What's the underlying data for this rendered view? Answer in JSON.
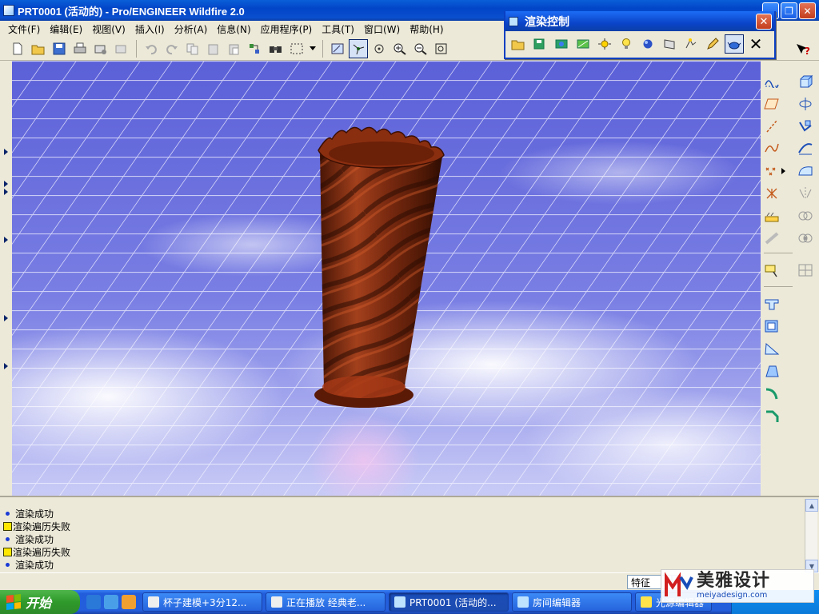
{
  "window": {
    "title": "PRT0001 (活动的) - Pro/ENGINEER Wildfire 2.0",
    "btn_minimize": "_",
    "btn_restore": "❐",
    "btn_close": "✕"
  },
  "menu": {
    "items": [
      "文件(F)",
      "编辑(E)",
      "视图(V)",
      "插入(I)",
      "分析(A)",
      "信息(N)",
      "应用程序(P)",
      "工具(T)",
      "窗口(W)",
      "帮助(H)"
    ]
  },
  "render_control": {
    "title": "渲染控制",
    "close_label": "✕",
    "close_glyph": "✕"
  },
  "messages": [
    {
      "type": "info",
      "text": "渲染成功"
    },
    {
      "type": "warning",
      "text": "渲染遍历失败"
    },
    {
      "type": "info",
      "text": "渲染成功"
    },
    {
      "type": "warning",
      "text": "渲染遍历失败"
    },
    {
      "type": "info",
      "text": "渲染成功"
    }
  ],
  "status": {
    "filter_value": "特征"
  },
  "taskbar": {
    "start_label": "开始",
    "tasks": [
      {
        "label": "杯子建模+3分12...",
        "active": false
      },
      {
        "label": "正在播放 经典老...",
        "active": false
      },
      {
        "label": "PRT0001 (活动的...",
        "active": true
      },
      {
        "label": "房间编辑器",
        "active": false
      },
      {
        "label": "光源编辑器",
        "active": false
      }
    ]
  },
  "watermark": {
    "brand": "美雅设计",
    "url": "meiyadesign.com"
  },
  "colors": {
    "accent": "#0a4fce",
    "cup": "#7a2a12",
    "floor": "#6a6ee0"
  }
}
